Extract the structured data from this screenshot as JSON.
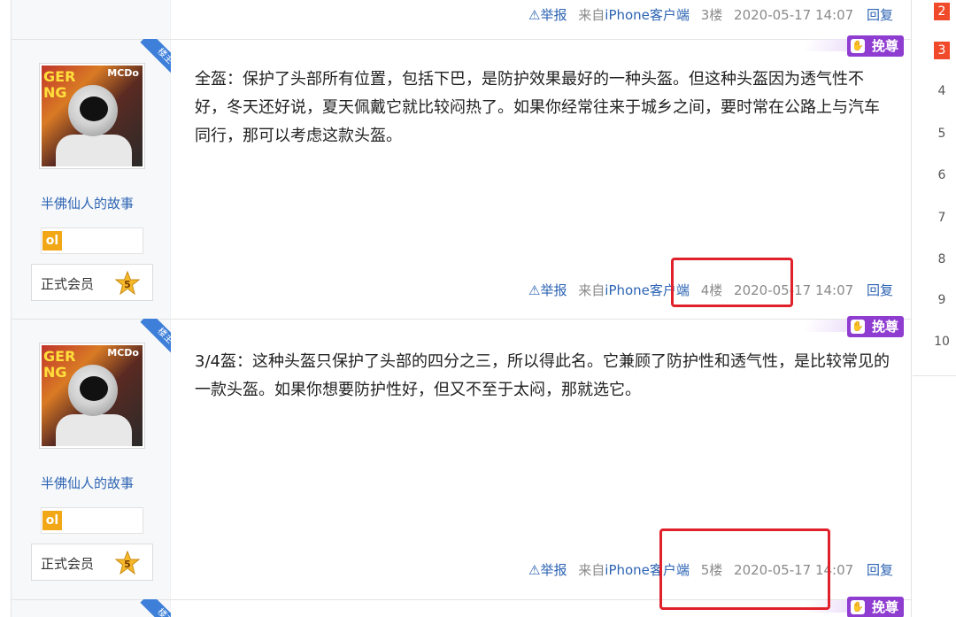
{
  "posts": [
    {
      "footer": {
        "report": "举报",
        "source_prefix": "来自",
        "source_link": "iPhone客户端",
        "floor": "3楼",
        "datetime": "2020-05-17 14:07",
        "reply": "回复"
      }
    },
    {
      "ribbon": "楼主",
      "username": "半佛仙人的故事",
      "level_icon": "ol",
      "member_label": "正式会员",
      "member_level": "5",
      "content": "全盔：保护了头部所有位置，包括下巴，是防护效果最好的一种头盔。但这种头盔因为透气性不好，冬天还好说，夏天佩戴它就比较闷热了。如果你经常往来于城乡之间，要时常在公路上与汽车同行，那可以考虑这款头盔。",
      "badge": "挽尊",
      "footer": {
        "report": "举报",
        "source_prefix": "来自",
        "source_link": "iPhone客户端",
        "floor": "4楼",
        "datetime": "2020-05-17 14:07",
        "reply": "回复"
      }
    },
    {
      "ribbon": "楼主",
      "username": "半佛仙人的故事",
      "level_icon": "ol",
      "member_label": "正式会员",
      "member_level": "5",
      "content": "3/4盔：这种头盔只保护了头部的四分之三，所以得此名。它兼顾了防护性和透气性，是比较常见的一款头盔。如果你想要防护性好，但又不至于太闷，那就选它。",
      "badge": "挽尊",
      "footer": {
        "report": "举报",
        "source_prefix": "来自",
        "source_link": "iPhone客户端",
        "floor": "5楼",
        "datetime": "2020-05-17 14:07",
        "reply": "回复"
      }
    },
    {
      "ribbon": "楼主",
      "badge": "挽尊"
    }
  ],
  "top_badge": "挽尊",
  "pager": {
    "pages": [
      "2",
      "3",
      "4",
      "5",
      "6",
      "7",
      "8",
      "9",
      "10"
    ],
    "current": "3"
  },
  "colors": {
    "link": "#2d64b3",
    "badge": "#8f3dd1",
    "ribbon": "#3d7fd9",
    "highlight": "#e0202a",
    "pager_active": "#f04a2a"
  }
}
